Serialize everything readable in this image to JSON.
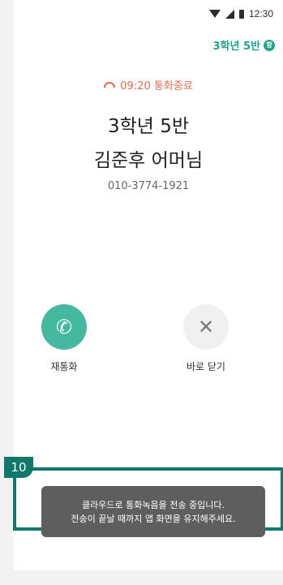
{
  "status_bar": {
    "time": "12:30",
    "icons": [
      "wifi-icon",
      "signal-icon",
      "battery-icon"
    ]
  },
  "header": {
    "class_label": "3학년 5반",
    "class_badge": "항"
  },
  "call": {
    "end_status": "09:20 통화종료",
    "end_icon": "call-end-icon",
    "class_name": "3학년 5반",
    "contact_name": "김준후 어머님",
    "phone_number": "010-3774-1921"
  },
  "actions": {
    "redial_label": "재통화",
    "close_label": "바로 닫기"
  },
  "annotation": {
    "number": "10"
  },
  "toast": {
    "line1": "클라우드로 통화녹음을 전송 중입니다.",
    "line2": "전송이 끝날 때까지 앱 화면을 유지해주세요."
  },
  "colors": {
    "accent": "#44b99f",
    "call_end": "#e66b4e",
    "annotation": "#0f7a6b"
  }
}
